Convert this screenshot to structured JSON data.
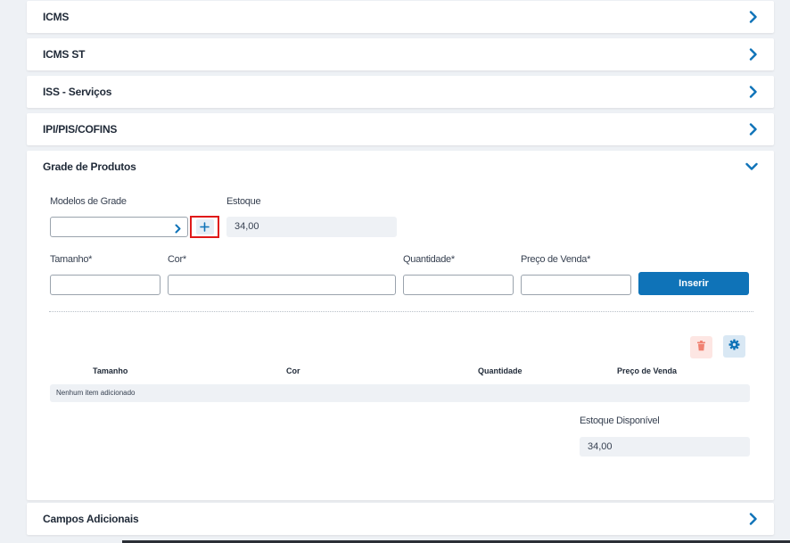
{
  "sections": {
    "icms": {
      "title": "ICMS"
    },
    "icms_st": {
      "title": "ICMS ST"
    },
    "iss": {
      "title": "ISS - Serviços"
    },
    "ipi": {
      "title": "IPI/PIS/COFINS"
    },
    "grade": {
      "title": "Grade de Produtos"
    },
    "campos": {
      "title": "Campos Adicionais"
    }
  },
  "grade": {
    "modelos_label": "Modelos de Grade",
    "modelos_value": "",
    "estoque_label": "Estoque",
    "estoque_value": "34,00",
    "tamanho_label": "Tamanho*",
    "cor_label": "Cor*",
    "quantidade_label": "Quantidade*",
    "preco_label": "Preço de Venda*",
    "tamanho_value": "",
    "cor_value": "",
    "quantidade_value": "",
    "preco_value": "",
    "insert_label": "Inserir",
    "table": {
      "headers": [
        "Tamanho",
        "Cor",
        "Quantidade",
        "Preço de Venda"
      ],
      "empty_text": "Nenhum item adicionado"
    },
    "estoque_disponivel_label": "Estoque Disponível",
    "estoque_disponivel_value": "34,00"
  },
  "icons": {
    "chevron_right": "chevron-right-icon",
    "chevron_down": "chevron-down-icon",
    "plus": "plus-icon",
    "trash": "trash-icon",
    "gear": "gear-icon"
  },
  "colors": {
    "accent": "#0f73b8",
    "background": "#eef1f5",
    "highlight": "#e01919",
    "danger": "#f08070"
  }
}
